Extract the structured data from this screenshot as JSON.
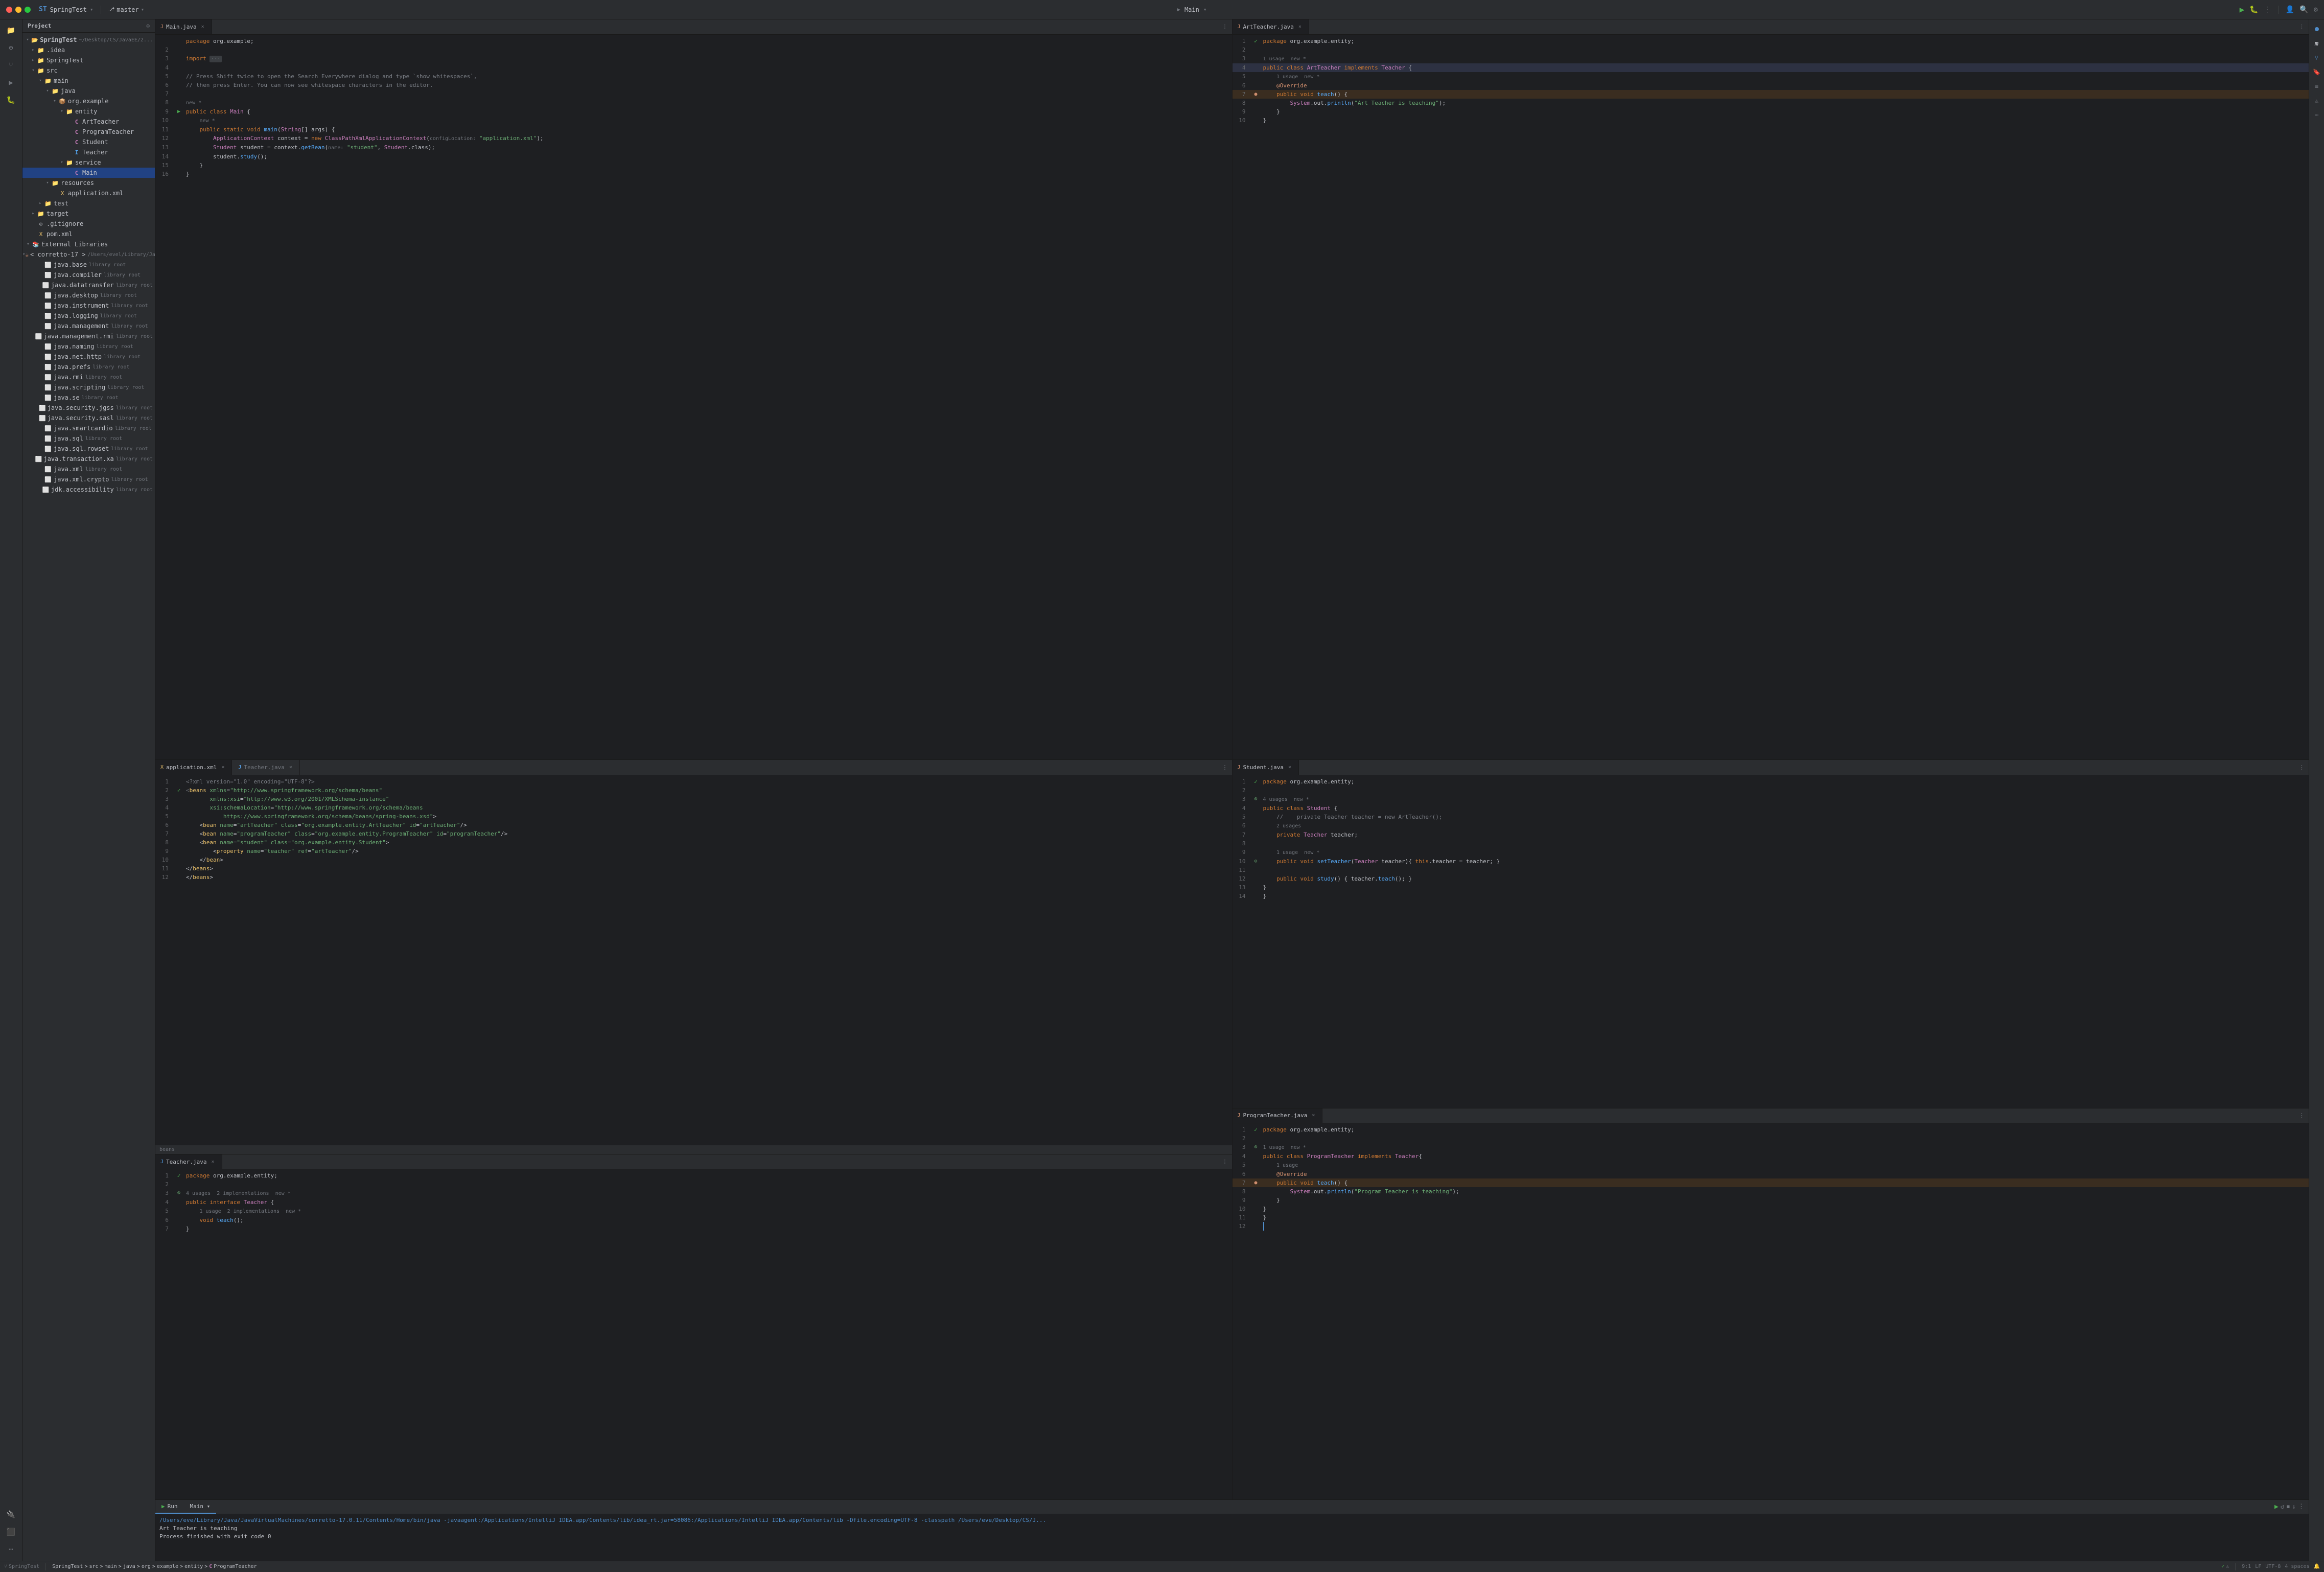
{
  "titleBar": {
    "projectName": "SpringTest",
    "branchName": "master",
    "runConfig": "Main"
  },
  "sidebar": {
    "title": "Project",
    "tree": [
      {
        "id": "springtest-root",
        "label": "SpringTest",
        "indent": 0,
        "type": "project",
        "arrow": "▾",
        "detail": "~/Desktop/CS/JavaEE/2 Java Spri..."
      },
      {
        "id": "idea",
        "label": ".idea",
        "indent": 1,
        "type": "folder",
        "arrow": "▸"
      },
      {
        "id": "springtest-src",
        "label": "SpringTest",
        "indent": 1,
        "type": "folder",
        "arrow": "▸"
      },
      {
        "id": "src",
        "label": "src",
        "indent": 2,
        "type": "folder",
        "arrow": "▾"
      },
      {
        "id": "main",
        "label": "main",
        "indent": 3,
        "type": "folder",
        "arrow": "▾"
      },
      {
        "id": "java",
        "label": "java",
        "indent": 4,
        "type": "java-folder",
        "arrow": "▾"
      },
      {
        "id": "org-example",
        "label": "org.example",
        "indent": 5,
        "type": "package",
        "arrow": "▾"
      },
      {
        "id": "entity",
        "label": "entity",
        "indent": 6,
        "type": "folder",
        "arrow": "▾"
      },
      {
        "id": "art-teacher",
        "label": "ArtTeacher",
        "indent": 7,
        "type": "java-class",
        "arrow": ""
      },
      {
        "id": "program-teacher",
        "label": "ProgramTeacher",
        "indent": 7,
        "type": "java-class",
        "arrow": ""
      },
      {
        "id": "student",
        "label": "Student",
        "indent": 7,
        "type": "java-class",
        "arrow": ""
      },
      {
        "id": "teacher",
        "label": "Teacher",
        "indent": 7,
        "type": "java-interface",
        "arrow": ""
      },
      {
        "id": "service",
        "label": "service",
        "indent": 6,
        "type": "folder",
        "arrow": "▾"
      },
      {
        "id": "main-class",
        "label": "Main",
        "indent": 7,
        "type": "java-class",
        "arrow": "",
        "selected": true
      },
      {
        "id": "resources",
        "label": "resources",
        "indent": 4,
        "type": "folder",
        "arrow": "▾"
      },
      {
        "id": "app-xml",
        "label": "application.xml",
        "indent": 5,
        "type": "xml",
        "arrow": ""
      },
      {
        "id": "test",
        "label": "test",
        "indent": 3,
        "type": "folder",
        "arrow": "▸"
      },
      {
        "id": "target",
        "label": "target",
        "indent": 2,
        "type": "folder",
        "arrow": "▸"
      },
      {
        "id": "gitignore",
        "label": ".gitignore",
        "indent": 2,
        "type": "file",
        "arrow": ""
      },
      {
        "id": "pom-xml",
        "label": "pom.xml",
        "indent": 2,
        "type": "xml",
        "arrow": ""
      },
      {
        "id": "external-libs",
        "label": "External Libraries",
        "indent": 0,
        "type": "folder",
        "arrow": "▾"
      },
      {
        "id": "corretto17",
        "label": "< corretto-17 >",
        "indent": 1,
        "type": "sdk",
        "arrow": "▾",
        "detail": "/Users/evel/Library/Java/Ja..."
      },
      {
        "id": "java-base",
        "label": "java.base",
        "indent": 2,
        "type": "jar",
        "arrow": "",
        "detail": "library root"
      },
      {
        "id": "java-compiler",
        "label": "java.compiler",
        "indent": 2,
        "type": "jar",
        "arrow": "",
        "detail": "library root"
      },
      {
        "id": "java-datatransfer",
        "label": "java.datatransfer",
        "indent": 2,
        "type": "jar",
        "arrow": "",
        "detail": "library root"
      },
      {
        "id": "java-desktop",
        "label": "java.desktop",
        "indent": 2,
        "type": "jar",
        "arrow": "",
        "detail": "library root"
      },
      {
        "id": "java-instrument",
        "label": "java.instrument",
        "indent": 2,
        "type": "jar",
        "arrow": "",
        "detail": "library root"
      },
      {
        "id": "java-logging",
        "label": "java.logging",
        "indent": 2,
        "type": "jar",
        "arrow": "",
        "detail": "library root"
      },
      {
        "id": "java-management",
        "label": "java.management",
        "indent": 2,
        "type": "jar",
        "arrow": "",
        "detail": "library root"
      },
      {
        "id": "java-management-ext",
        "label": "java.management.rmi",
        "indent": 2,
        "type": "jar",
        "arrow": "",
        "detail": "library root"
      },
      {
        "id": "java-naming",
        "label": "java.naming",
        "indent": 2,
        "type": "jar",
        "arrow": "",
        "detail": "library root"
      },
      {
        "id": "java-net-http",
        "label": "java.net.http",
        "indent": 2,
        "type": "jar",
        "arrow": "",
        "detail": "library root"
      },
      {
        "id": "java-prefs",
        "label": "java.prefs",
        "indent": 2,
        "type": "jar",
        "arrow": "",
        "detail": "library root"
      },
      {
        "id": "java-rmi",
        "label": "java.rmi",
        "indent": 2,
        "type": "jar",
        "arrow": "",
        "detail": "library root"
      },
      {
        "id": "java-scripting",
        "label": "java.scripting",
        "indent": 2,
        "type": "jar",
        "arrow": "",
        "detail": "library root"
      },
      {
        "id": "java-se",
        "label": "java.se",
        "indent": 2,
        "type": "jar",
        "arrow": "",
        "detail": "library root"
      },
      {
        "id": "java-security-jgss",
        "label": "java.security.jgss",
        "indent": 2,
        "type": "jar",
        "arrow": "",
        "detail": "library root"
      },
      {
        "id": "java-security-sasl",
        "label": "java.security.sasl",
        "indent": 2,
        "type": "jar",
        "arrow": "",
        "detail": "library root"
      },
      {
        "id": "java-smartcardio",
        "label": "java.smartcardio",
        "indent": 2,
        "type": "jar",
        "arrow": "",
        "detail": "library root"
      },
      {
        "id": "java-sql",
        "label": "java.sql",
        "indent": 2,
        "type": "jar",
        "arrow": "",
        "detail": "library root"
      },
      {
        "id": "java-sql-rowset",
        "label": "java.sql.rowset",
        "indent": 2,
        "type": "jar",
        "arrow": "",
        "detail": "library root"
      },
      {
        "id": "java-transaction-xa",
        "label": "java.transaction.xa",
        "indent": 2,
        "type": "jar",
        "arrow": "",
        "detail": "library root"
      },
      {
        "id": "java-xml",
        "label": "java.xml",
        "indent": 2,
        "type": "jar",
        "arrow": "",
        "detail": "library root"
      },
      {
        "id": "java-xml-crypto",
        "label": "java.xml.crypto",
        "indent": 2,
        "type": "jar",
        "arrow": "",
        "detail": "library root"
      },
      {
        "id": "jdk-accessibility",
        "label": "jdk.accessibility",
        "indent": 2,
        "type": "jar",
        "arrow": "",
        "detail": "library root"
      }
    ]
  },
  "editors": {
    "topLeft": {
      "tabs": [
        {
          "label": "Main.java",
          "active": true,
          "icon": "J"
        },
        {
          "label": "",
          "active": false
        }
      ],
      "filename": "Main.java",
      "lines": [
        {
          "num": "",
          "content": "    package org.example;"
        },
        {
          "num": "2",
          "content": ""
        },
        {
          "num": "3",
          "content": "    import ..."
        },
        {
          "num": "4",
          "content": ""
        },
        {
          "num": "5",
          "content": "    // Press Shift twice to open the Search Everywhere dialog and type `show whitespaces`,"
        },
        {
          "num": "6",
          "content": "    // then press Enter. You can now see whitespace characters in the editor."
        },
        {
          "num": "7",
          "content": ""
        },
        {
          "num": "8",
          "content": "    new *"
        },
        {
          "num": "9",
          "content": "    public class Main {"
        },
        {
          "num": "10",
          "content": "        new *"
        },
        {
          "num": "11",
          "content": "        public static void main(String[] args) {"
        },
        {
          "num": "12",
          "content": "            ApplicationContext context = new ClassPathXmlApplicationContext( configLocation: \"application.xml\");"
        },
        {
          "num": "13",
          "content": "            Student student = context.getBean( name: \"student\", Student.class);"
        },
        {
          "num": "14",
          "content": "            student.study();"
        },
        {
          "num": "15",
          "content": "        }"
        },
        {
          "num": "16",
          "content": "    }"
        }
      ]
    },
    "topRight": {
      "tabs": [
        {
          "label": "ArtTeacher.java",
          "active": true,
          "icon": "J"
        }
      ],
      "filename": "ArtTeacher.java",
      "lines": [
        {
          "num": "1",
          "content": "    package org.example.entity;"
        },
        {
          "num": "2",
          "content": ""
        },
        {
          "num": "3",
          "content": "    1 usage  new *"
        },
        {
          "num": "4",
          "content": "    public class ArtTeacher implements Teacher {"
        },
        {
          "num": "5",
          "content": "        1 usage  new *"
        },
        {
          "num": "6",
          "content": "        @Override"
        },
        {
          "num": "7",
          "content": "        public void teach() {"
        },
        {
          "num": "8",
          "content": "            System.out.println(\"Art Teacher is teaching\");"
        },
        {
          "num": "9",
          "content": "        }"
        },
        {
          "num": "10",
          "content": "    }"
        }
      ]
    },
    "bottomLeft": {
      "tabs": [
        {
          "label": "application.xml",
          "active": true,
          "icon": "X"
        },
        {
          "label": "Teacher.java",
          "active": false,
          "icon": "J"
        }
      ],
      "filename": "application.xml",
      "lines": [
        {
          "num": "1",
          "content": "    <?xml version=\"1.0\" encoding=\"UTF-8\"?>"
        },
        {
          "num": "2",
          "content": "    <beans xmlns=\"http://www.springframework.org/schema/beans\""
        },
        {
          "num": "3",
          "content": "           xmlns:xsi=\"http://www.w3.org/2001/XMLSchema-instance\""
        },
        {
          "num": "4",
          "content": "           xsi:schemaLocation=\"http://www.springframework.org/schema/beans"
        },
        {
          "num": "5",
          "content": "               https://www.springframework.org/schema/beans/spring-beans.xsd\">"
        },
        {
          "num": "6",
          "content": "        <bean name=\"artTeacher\" class=\"org.example.entity.ArtTeacher\" id=\"artTeacher\"/>"
        },
        {
          "num": "7",
          "content": "        <bean name=\"programTeacher\" class=\"org.example.entity.ProgramTeacher\" id=\"programTeacher\"/>"
        },
        {
          "num": "8",
          "content": "        <bean name=\"student\" class=\"org.example.entity.Student\">"
        },
        {
          "num": "9",
          "content": "            <property name=\"teacher\" ref=\"artTeacher\"/>"
        },
        {
          "num": "10",
          "content": "        </bean>"
        },
        {
          "num": "11",
          "content": "    </beans>"
        },
        {
          "num": "12",
          "content": "    </beans>"
        }
      ],
      "bottomLabel": "beans",
      "teacherTab": {
        "filename": "Teacher.java",
        "lines": [
          {
            "num": "1",
            "content": "    package org.example.entity;"
          },
          {
            "num": "2",
            "content": ""
          },
          {
            "num": "3",
            "content": "    4 usages  2 implementations  new *"
          },
          {
            "num": "4",
            "content": "    public interface Teacher {"
          },
          {
            "num": "5",
            "content": "        1 usage  2 implementations  new *"
          },
          {
            "num": "6",
            "content": "        void teach();"
          },
          {
            "num": "7",
            "content": "    }"
          }
        ]
      }
    },
    "bottomRight": {
      "tabs": [
        {
          "label": "Student.java",
          "active": true,
          "icon": "J"
        },
        {
          "label": "ProgramTeacher.java",
          "active": false,
          "icon": "J"
        }
      ],
      "studentFile": {
        "filename": "Student.java",
        "lines": [
          {
            "num": "1",
            "content": "    package org.example.entity;"
          },
          {
            "num": "2",
            "content": ""
          },
          {
            "num": "3",
            "content": "    4 usages  new *"
          },
          {
            "num": "4",
            "content": "    public class Student {"
          },
          {
            "num": "5",
            "content": "        //    private Teacher teacher = new ArtTeacher();"
          },
          {
            "num": "6",
            "content": "        2 usages"
          },
          {
            "num": "7",
            "content": "        private Teacher teacher;"
          },
          {
            "num": "8",
            "content": ""
          },
          {
            "num": "9",
            "content": "        1 usage  new *"
          },
          {
            "num": "10",
            "content": "        public void setTeacher(Teacher teacher){ this.teacher = teacher; }"
          },
          {
            "num": "11",
            "content": ""
          },
          {
            "num": "12",
            "content": "        public void study() { teacher.teach(); }"
          },
          {
            "num": "13",
            "content": "    }"
          },
          {
            "num": "14",
            "content": "    }"
          }
        ]
      },
      "programTeacherFile": {
        "filename": "ProgramTeacher.java",
        "lines": [
          {
            "num": "1",
            "content": "    package org.example.entity;"
          },
          {
            "num": "2",
            "content": ""
          },
          {
            "num": "3",
            "content": "    1 usage  new *"
          },
          {
            "num": "4",
            "content": "    public class ProgramTeacher implements Teacher{"
          },
          {
            "num": "5",
            "content": "        1 usage"
          },
          {
            "num": "6",
            "content": "        @Override"
          },
          {
            "num": "7",
            "content": "        public void teach() {"
          },
          {
            "num": "8",
            "content": "            System.out.println(\"Program Teacher is teaching\");"
          },
          {
            "num": "9",
            "content": "        }"
          },
          {
            "num": "10",
            "content": "    }"
          },
          {
            "num": "11",
            "content": "    }"
          },
          {
            "num": "12",
            "content": "    |"
          }
        ]
      }
    }
  },
  "bottomPanel": {
    "tabs": [
      "Run",
      "Main ▾"
    ],
    "runIcons": [
      "▶",
      "↺",
      "⏹",
      "↓"
    ],
    "consoleLine1": "/Users/eve/Library/Java/JavaVirtualMachines/corretto-17.0.11/Contents/Home/bin/java -javaagent:/Applications/IntelliJ IDEA.app/Contents/lib/idea_rt.jar=58086:/Applications/IntelliJ IDEA.app/Contents/lib -Dfile.encoding=UTF-8 -classpath /Users/eve/Desktop/CS/J...",
    "consoleLine2": "Art Teacher is teaching",
    "consoleLine3": "Process finished with exit code 0"
  },
  "statusBar": {
    "breadcrumb": [
      "SpringTest",
      ">",
      "src",
      ">",
      "main",
      ">",
      "java",
      ">",
      "org",
      ">",
      "example",
      ">",
      "entity",
      ">",
      "ProgramTeacher"
    ],
    "position": "9:1",
    "lf": "LF",
    "encoding": "UTF-8",
    "indent": "4 spaces"
  }
}
